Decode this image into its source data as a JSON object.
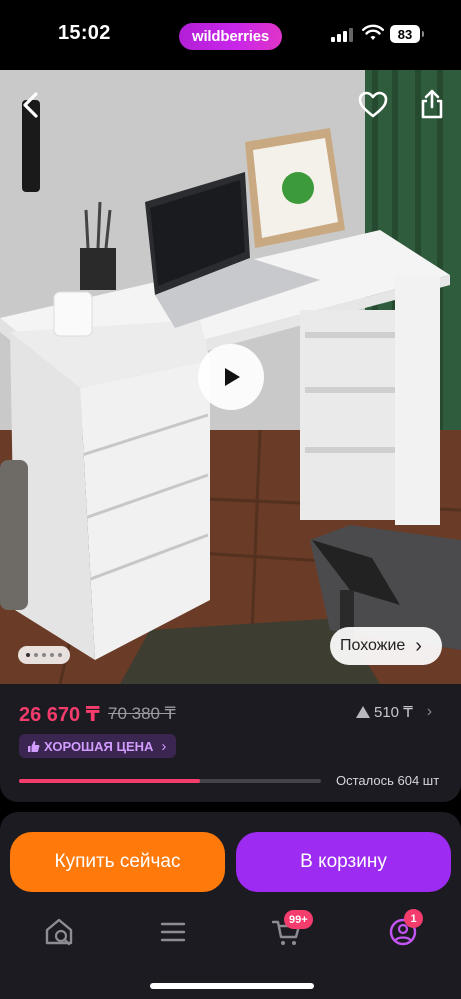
{
  "status_bar": {
    "time": "15:02",
    "brand": "wildberries",
    "battery": "83",
    "icons": [
      "signal-icon",
      "wifi-icon",
      "battery-icon"
    ]
  },
  "hero": {
    "icons": [
      "back-arrow-icon",
      "heart-icon",
      "share-icon",
      "play-icon"
    ],
    "similar_label": "Похожие",
    "similar_chevron": "›",
    "gallery_dots": 5
  },
  "price": {
    "current": "26 670 ₸",
    "old": "70 380 ₸",
    "rating_link": "510 ₸",
    "good_price": "ХОРОШАЯ ЦЕНА",
    "good_price_chevron": "›",
    "stock_text": "Осталось 604 шт",
    "stock_fraction": 0.6
  },
  "actions": {
    "buy_now": "Купить сейчас",
    "add_to_cart": "В корзину"
  },
  "tabbar": {
    "items": [
      {
        "icon": "home-search-icon"
      },
      {
        "icon": "menu-icon"
      },
      {
        "icon": "cart-icon",
        "badge": "99+"
      },
      {
        "icon": "profile-icon",
        "badge": "1"
      }
    ]
  },
  "colors": {
    "accent_pink": "#f43c6d",
    "buy_orange": "#ff7a0a",
    "cart_purple": "#9d2bf2",
    "card_bg": "#1c1b21"
  }
}
